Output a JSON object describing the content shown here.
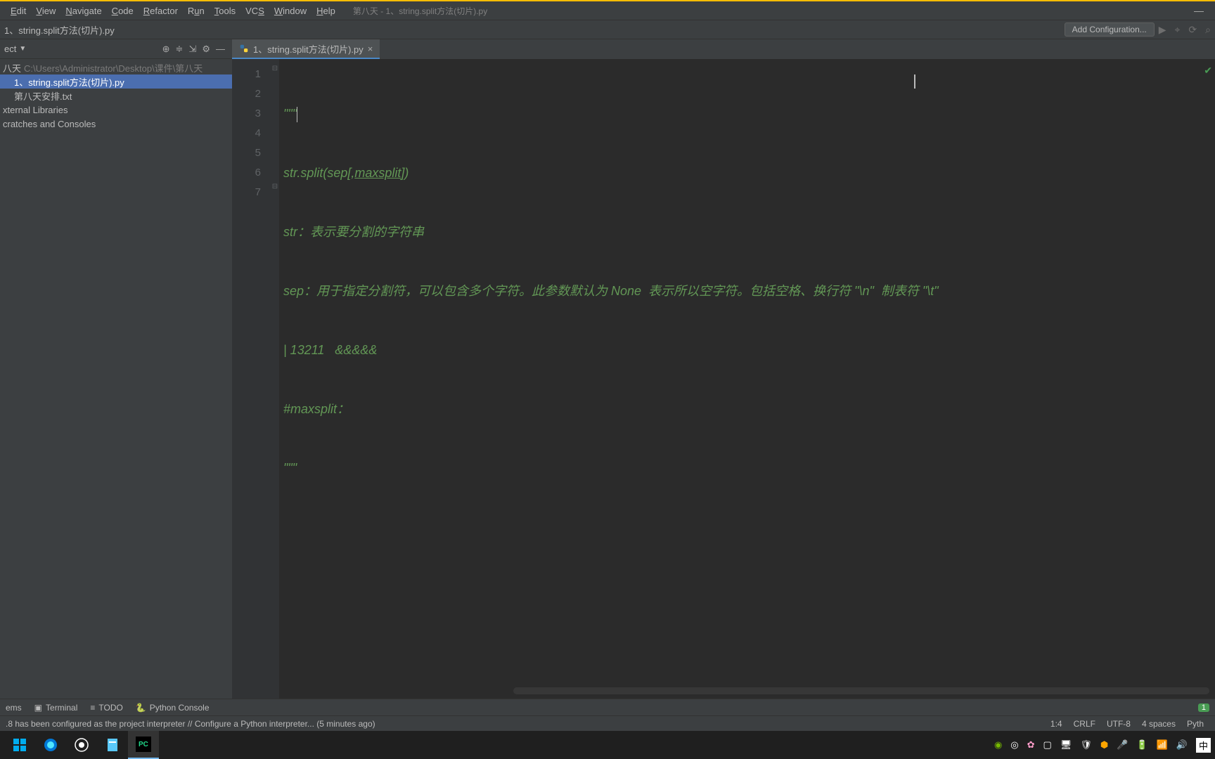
{
  "window_title": "第八天 - 1、string.split方法(切片).py",
  "menu": [
    "Edit",
    "View",
    "Navigate",
    "Code",
    "Refactor",
    "Run",
    "Tools",
    "VCS",
    "Window",
    "Help"
  ],
  "menu_underline": [
    0,
    0,
    0,
    0,
    0,
    0,
    0,
    2,
    0,
    0
  ],
  "breadcrumb": "1、string.split方法(切片).py",
  "add_config": "Add Configuration...",
  "project_label": "ect",
  "tree": {
    "root": {
      "label": "八天",
      "path": "C:\\Users\\Administrator\\Desktop\\课件\\第八天"
    },
    "file_sel": "1、string.split方法(切片).py",
    "file2": "第八天安排.txt",
    "ext": "xternal Libraries",
    "scratch": "cratches and Consoles"
  },
  "tab_name": "1、string.split方法(切片).py",
  "code_lines": [
    {
      "n": 1,
      "t": "\"\"\""
    },
    {
      "n": 2,
      "t": "str.split(sep[,maxsplit])"
    },
    {
      "n": 3,
      "t": "str：表示要分割的字符串"
    },
    {
      "n": 4,
      "t": "sep：用于指定分割符，可以包含多个字符。此参数默认为 None  表示所以空字符。包括空格、换行符 \"\\n\"  制表符 \"\\t\""
    },
    {
      "n": 5,
      "t": "| 13211   &&&&&"
    },
    {
      "n": 6,
      "t": "#maxsplit："
    },
    {
      "n": 7,
      "t": "\"\"\""
    }
  ],
  "tool_windows": {
    "problems": "ems",
    "terminal": "Terminal",
    "todo": "TODO",
    "pyconsole": "Python Console",
    "badge": "1"
  },
  "status_msg": ".8 has been configured as the project interpreter // Configure a Python interpreter... (5 minutes ago)",
  "status": {
    "pos": "1:4",
    "sep": "CRLF",
    "enc": "UTF-8",
    "indent": "4 spaces",
    "lang": "Pyth"
  },
  "ime": "中"
}
